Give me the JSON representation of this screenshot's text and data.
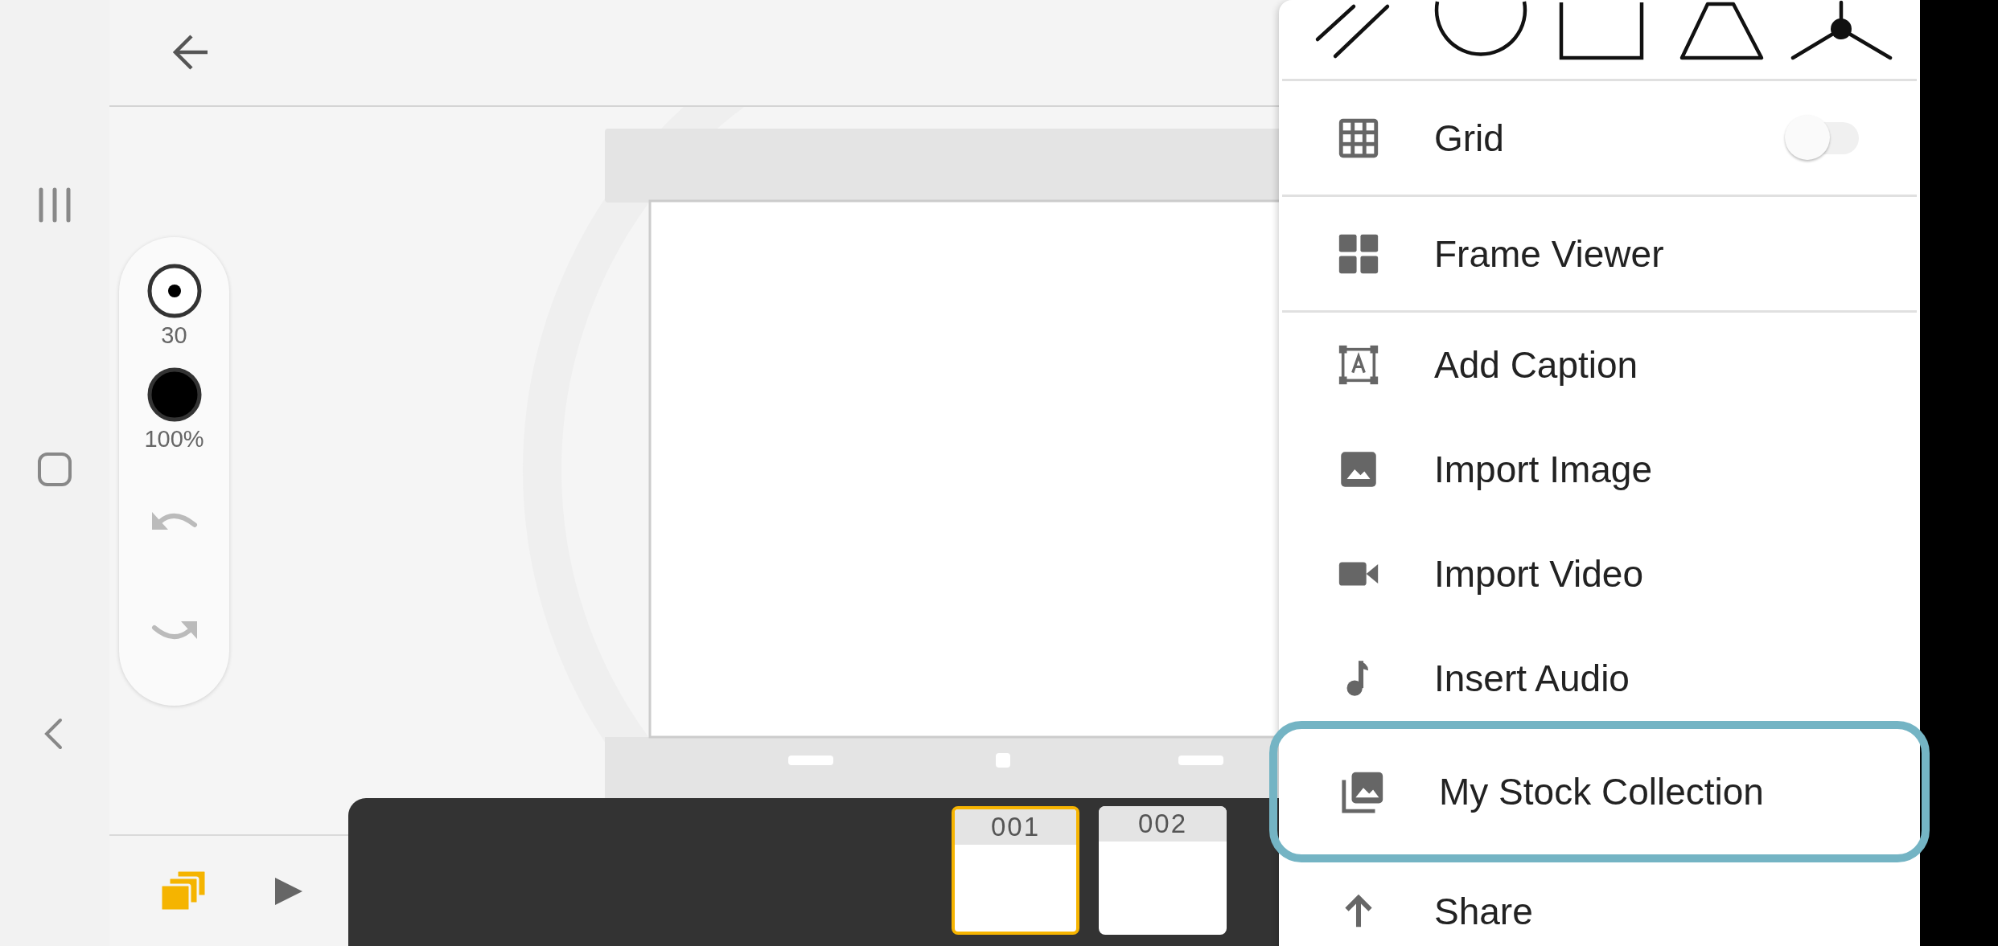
{
  "tool_panel": {
    "brush_size": "30",
    "opacity": "100%"
  },
  "timeline": {
    "frames": [
      {
        "label": "001",
        "selected": true
      },
      {
        "label": "002",
        "selected": false
      }
    ]
  },
  "menu": {
    "items": [
      {
        "kind": "grid",
        "label": "Grid",
        "toggle_on": false,
        "selected": false
      },
      {
        "kind": "frames",
        "label": "Frame Viewer",
        "selected": false
      },
      {
        "kind": "caption",
        "label": "Add Caption",
        "selected": false
      },
      {
        "kind": "image",
        "label": "Import Image",
        "selected": false
      },
      {
        "kind": "video",
        "label": "Import Video",
        "selected": false
      },
      {
        "kind": "audio",
        "label": "Insert Audio",
        "selected": false
      },
      {
        "kind": "stock",
        "label": "My Stock Collection",
        "selected": true
      },
      {
        "kind": "share",
        "label": "Share",
        "selected": false
      }
    ]
  }
}
